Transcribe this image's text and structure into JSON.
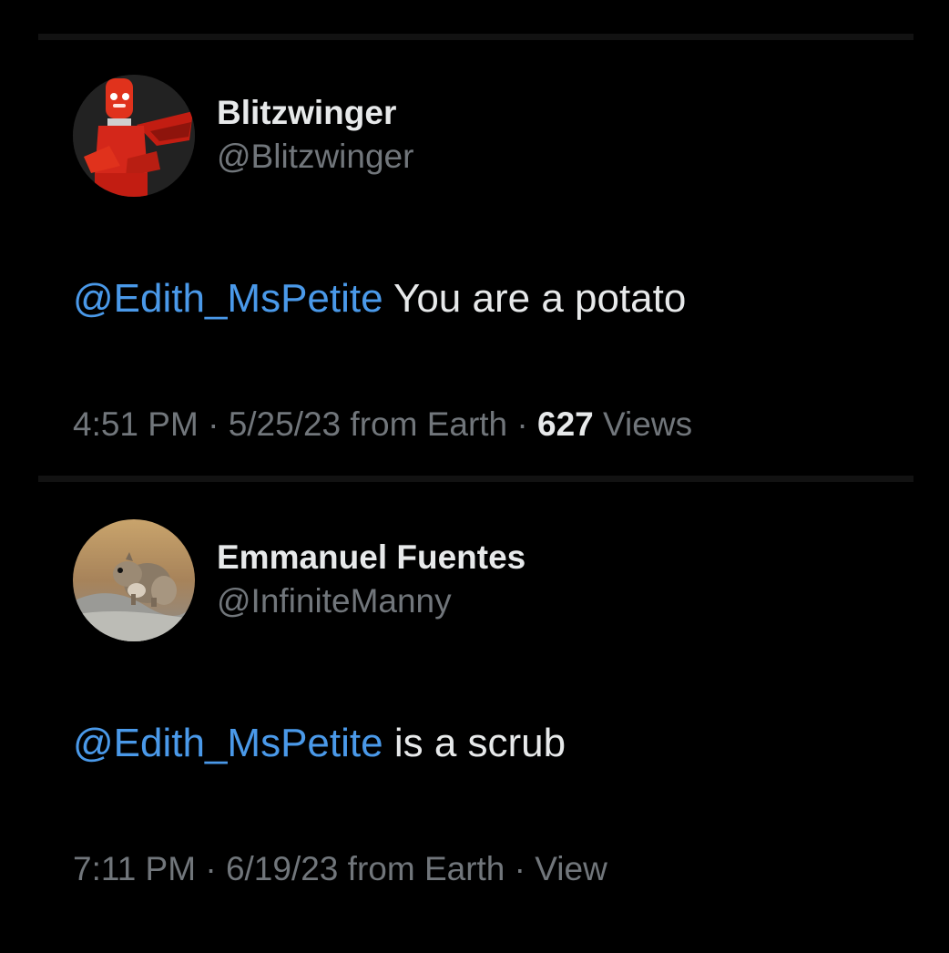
{
  "tweets": [
    {
      "display_name": "Blitzwinger",
      "handle": "@Blitzwinger",
      "avatar_icon": "red-robot-avatar",
      "mention": "@Edith_MsPetite",
      "text": " You are a potato",
      "time": "4:51 PM",
      "date_source": "5/25/23 from Earth",
      "separator": "·",
      "views_count": "627",
      "views_label": " Views"
    },
    {
      "display_name": "Emmanuel Fuentes",
      "handle": "@InfiniteManny",
      "avatar_icon": "squirrel-photo-avatar",
      "mention": "@Edith_MsPetite",
      "text": " is a scrub",
      "time": "7:11 PM",
      "date_source": "6/19/23 from Earth",
      "separator": "·",
      "views_label": "View"
    }
  ],
  "colors": {
    "background": "#000000",
    "primary_text": "#e7e9ea",
    "secondary_text": "#71767b",
    "mention": "#4a99e9",
    "divider": "#121212"
  }
}
